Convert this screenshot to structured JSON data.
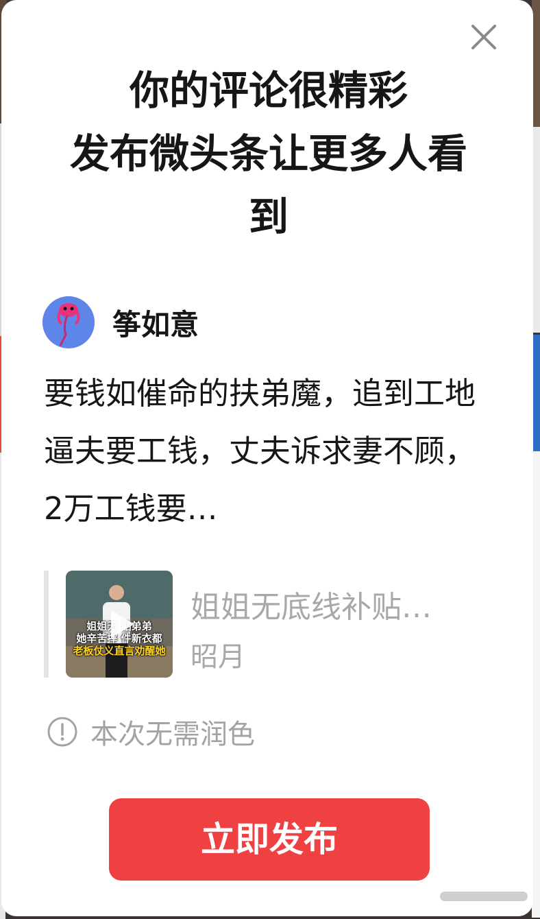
{
  "modal": {
    "title_line1": "你的评论很精彩",
    "title_line2": "发布微头条让更多人看",
    "title_line3": "到",
    "close_icon": "close-icon"
  },
  "user": {
    "name": "筝如意",
    "avatar_icon": "kite-avatar"
  },
  "comment": {
    "text": "要钱如催命的扶弟魔，追到工地逼夫要工钱，丈夫诉求妻不顾，2万工钱要…"
  },
  "video": {
    "title": "姐姐无底线补贴…",
    "author": "昭月",
    "thumbnail_caption_1": "姐姐无    贴弟弟",
    "thumbnail_caption_2": "她辛苦摔    件新衣都",
    "thumbnail_caption_3": "老板仗义直言劝醒她",
    "play_icon": "play-icon"
  },
  "notice": {
    "icon": "info-icon",
    "text": "本次无需润色"
  },
  "actions": {
    "publish_label": "立即发布"
  },
  "colors": {
    "accent": "#f04142",
    "text_primary": "#161616",
    "text_muted": "#a8a8a8",
    "avatar_bg": "#5e86e8"
  }
}
